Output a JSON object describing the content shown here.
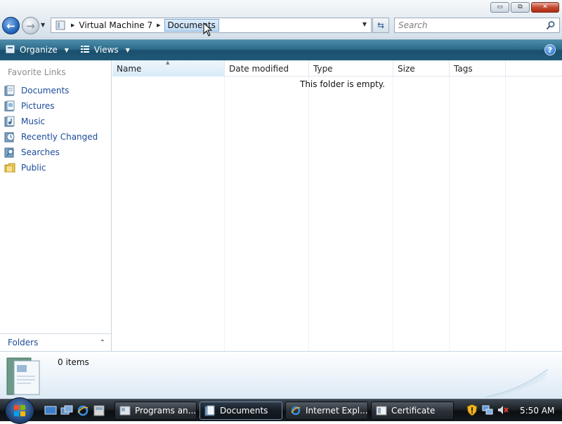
{
  "window": {
    "controls": {
      "minimize": "▭",
      "maximize": "⧉",
      "close": "✕"
    }
  },
  "nav": {
    "back_icon": "back-arrow-icon",
    "forward_icon": "forward-arrow-icon"
  },
  "address": {
    "breadcrumbs": [
      "Virtual Machine 7",
      "Documents"
    ]
  },
  "search": {
    "placeholder": "Search"
  },
  "commandbar": {
    "organize_label": "Organize",
    "views_label": "Views",
    "help_label": "?"
  },
  "navpane": {
    "heading": "Favorite Links",
    "items": [
      {
        "label": "Documents",
        "icon": "documents-icon"
      },
      {
        "label": "Pictures",
        "icon": "pictures-icon"
      },
      {
        "label": "Music",
        "icon": "music-icon"
      },
      {
        "label": "Recently Changed",
        "icon": "recently-changed-icon"
      },
      {
        "label": "Searches",
        "icon": "searches-icon"
      },
      {
        "label": "Public",
        "icon": "public-folder-icon"
      }
    ],
    "folders_label": "Folders"
  },
  "filelist": {
    "columns": [
      "Name",
      "Date modified",
      "Type",
      "Size",
      "Tags"
    ],
    "empty_message": "This folder is empty."
  },
  "details": {
    "item_count": "0 items"
  },
  "taskbar": {
    "buttons": [
      {
        "label": "Programs an...",
        "active": false
      },
      {
        "label": "Documents",
        "active": true
      },
      {
        "label": "Internet Expl...",
        "active": false
      },
      {
        "label": "Certificate",
        "active": false
      }
    ],
    "clock": "5:50 AM"
  },
  "colors": {
    "link_blue": "#1b4a9a",
    "commandbar": "#2d6c8b",
    "taskbar": "#151a1f"
  }
}
